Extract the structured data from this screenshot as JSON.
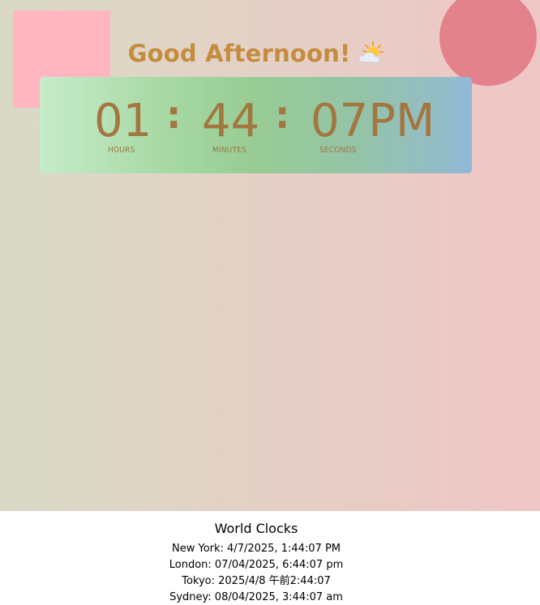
{
  "greeting": {
    "text": "Good Afternoon!",
    "icon": "sun-behind-cloud-icon"
  },
  "clock": {
    "hours": "01",
    "minutes": "44",
    "seconds": "07",
    "period": "PM",
    "separator": ":",
    "hours_label": "HOURS",
    "minutes_label": "MINUTES",
    "seconds_label": "SECONDS"
  },
  "world_clocks": {
    "title": "World Clocks",
    "zones": [
      {
        "text": "New York: 4/7/2025, 1:44:07 PM"
      },
      {
        "text": "London: 07/04/2025, 6:44:07 pm"
      },
      {
        "text": "Tokyo: 2025/4/8 午前2:44:07"
      },
      {
        "text": "Sydney: 08/04/2025, 3:44:07 am"
      }
    ]
  },
  "colors": {
    "accent_text": "#a3763f",
    "greeting_text": "#c48c3e",
    "deco_square": "#ffb6c1",
    "deco_circle": "#e3828a"
  }
}
